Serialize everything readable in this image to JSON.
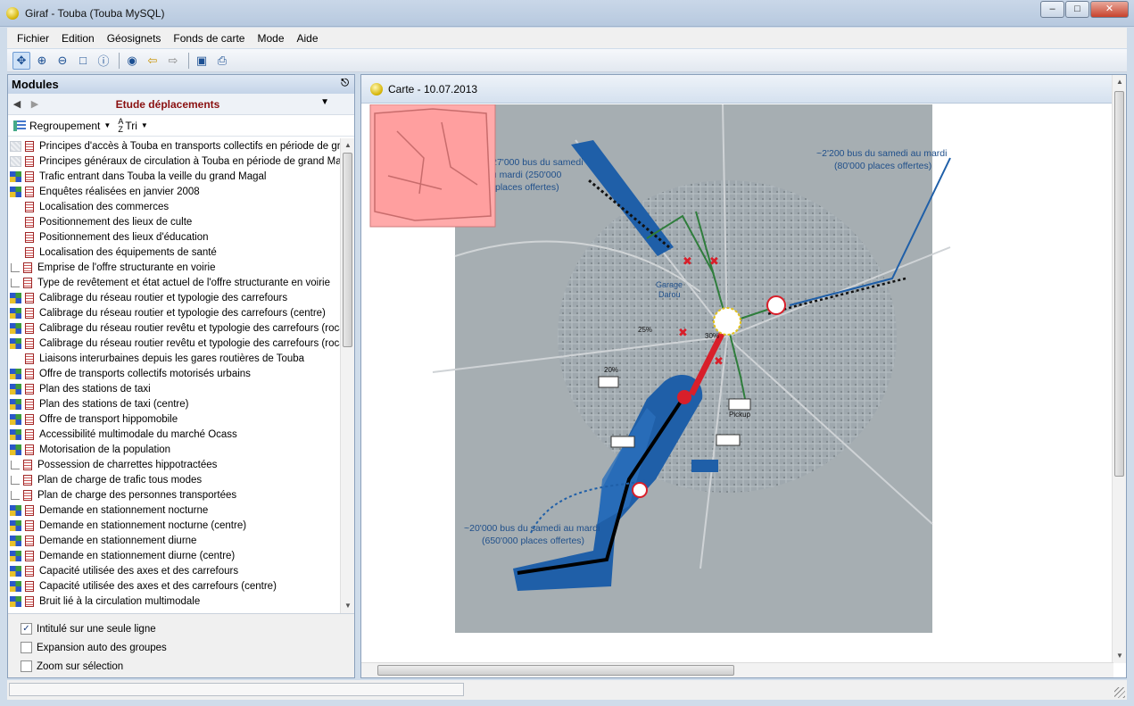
{
  "window": {
    "title": "Giraf - Touba  (Touba MySQL)"
  },
  "menu": [
    "Fichier",
    "Edition",
    "Géosignets",
    "Fonds de carte",
    "Mode",
    "Aide"
  ],
  "toolbar": [
    "pan-icon",
    "zoom-in-icon",
    "zoom-out-icon",
    "zoom-box-icon",
    "info-icon",
    "globe-icon",
    "back-icon",
    "forward-icon",
    "save-icon",
    "print-icon"
  ],
  "modules": {
    "title": "Modules",
    "current": "Etude déplacements",
    "grouping_label": "Regroupement",
    "sort_label": "Tri",
    "items": [
      {
        "label": "Principes d'accès à Touba en transports collectifs en période de grand Magal",
        "state": "off"
      },
      {
        "label": "Principes généraux de circulation à Touba en période de grand Magal",
        "state": "off"
      },
      {
        "label": "Trafic entrant dans Touba la veille du grand Magal",
        "state": "on"
      },
      {
        "label": "Enquêtes réalisées en janvier 2008",
        "state": "on"
      },
      {
        "label": "Localisation des commerces",
        "state": "none"
      },
      {
        "label": "Positionnement des lieux de culte",
        "state": "none"
      },
      {
        "label": "Positionnement des lieux d'éducation",
        "state": "none"
      },
      {
        "label": "Localisation des équipements de santé",
        "state": "none"
      },
      {
        "label": "Emprise de l'offre structurante en voirie",
        "state": "layer"
      },
      {
        "label": "Type de revêtement et état actuel  de l'offre structurante en voirie",
        "state": "layer"
      },
      {
        "label": "Calibrage du réseau routier et typologie des carrefours",
        "state": "on"
      },
      {
        "label": "Calibrage du réseau routier et typologie des carrefours (centre)",
        "state": "on"
      },
      {
        "label": "Calibrage du réseau routier revêtu et typologie des carrefours (rocade)",
        "state": "on"
      },
      {
        "label": "Calibrage du réseau routier revêtu et typologie des carrefours (rocade)",
        "state": "on"
      },
      {
        "label": "Liaisons interurbaines depuis les gares routières de Touba",
        "state": "none"
      },
      {
        "label": "Offre de transports collectifs motorisés urbains",
        "state": "on"
      },
      {
        "label": "Plan des stations de taxi",
        "state": "on"
      },
      {
        "label": "Plan des stations de taxi (centre)",
        "state": "on"
      },
      {
        "label": "Offre de transport hippomobile",
        "state": "on"
      },
      {
        "label": "Accessibilité multimodale du marché Ocass",
        "state": "on"
      },
      {
        "label": "Motorisation de la population",
        "state": "on"
      },
      {
        "label": "Possession de charrettes hippotractées",
        "state": "layer"
      },
      {
        "label": "Plan de charge de trafic tous modes",
        "state": "layer"
      },
      {
        "label": "Plan de charge des personnes transportées",
        "state": "layer"
      },
      {
        "label": "Demande en stationnement nocturne",
        "state": "on"
      },
      {
        "label": "Demande en stationnement nocturne (centre)",
        "state": "on"
      },
      {
        "label": "Demande en stationnement diurne",
        "state": "on"
      },
      {
        "label": "Demande en stationnement diurne (centre)",
        "state": "on"
      },
      {
        "label": "Capacité utilisée des axes et des carrefours",
        "state": "on"
      },
      {
        "label": "Capacité utilisée des axes et des carrefours (centre)",
        "state": "on"
      },
      {
        "label": "Bruit lié à la circulation multimodale",
        "state": "on"
      }
    ],
    "options": [
      {
        "label": "Intitulé sur une seule ligne",
        "checked": true
      },
      {
        "label": "Expansion auto des groupes",
        "checked": false
      },
      {
        "label": "Zoom sur sélection",
        "checked": false
      }
    ]
  },
  "map": {
    "tab_title": "Carte - 10.07.2013",
    "annotations": {
      "north_a": "~27'000 bus du samedi",
      "north_b": "au mardi (250'000",
      "north_c": "places offertes)",
      "ne_a": "~2'200 bus du samedi au mardi",
      "ne_b": "(80'000 places offertes)",
      "sw_a": "~20'000 bus du samedi au mardi",
      "sw_b": "(650'000 places offertes)",
      "garage_a": "Garage",
      "garage_b": "Darou",
      "pct_25": "25%",
      "pct_20": "20%",
      "pct_30": "30%",
      "pickup": "Pickup"
    },
    "colors": {
      "route_blue": "#1f5fa8",
      "route_green": "#2f7d3c",
      "route_red": "#d81f2a",
      "overview_fill": "#ffaaaa"
    }
  }
}
